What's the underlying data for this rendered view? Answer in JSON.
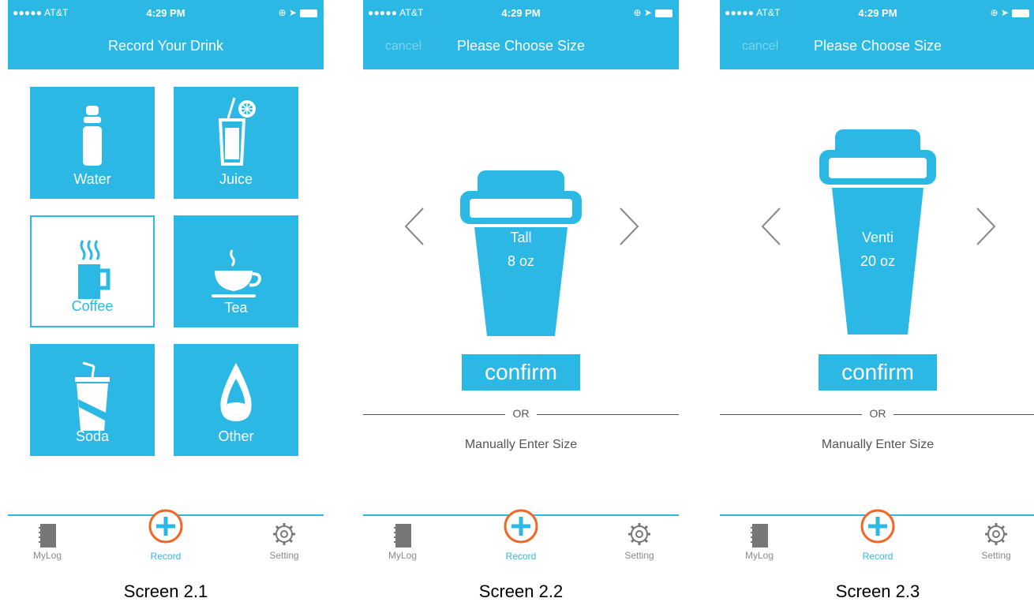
{
  "status": {
    "carrier": "●●●●● AT&T",
    "time": "4:29 PM"
  },
  "screen1": {
    "title": "Record Your Drink",
    "tiles": [
      {
        "label": "Water",
        "icon": "water-bottle-icon"
      },
      {
        "label": "Juice",
        "icon": "juice-glass-icon"
      },
      {
        "label": "Coffee",
        "icon": "coffee-mug-icon",
        "selected": true
      },
      {
        "label": "Tea",
        "icon": "tea-cup-icon"
      },
      {
        "label": "Soda",
        "icon": "soda-cup-icon"
      },
      {
        "label": "Other",
        "icon": "drop-icon"
      }
    ]
  },
  "screen2": {
    "cancel": "cancel",
    "title": "Please Choose Size",
    "size_name": "Tall",
    "size_oz": "8 oz",
    "confirm": "confirm",
    "or": "OR",
    "manual": "Manually Enter Size"
  },
  "screen3": {
    "cancel": "cancel",
    "title": "Please Choose Size",
    "size_name": "Venti",
    "size_oz": "20 oz",
    "confirm": "confirm",
    "or": "OR",
    "manual": "Manually Enter Size"
  },
  "tabbar": {
    "mylog": "MyLog",
    "record": "Record",
    "setting": "Setting"
  },
  "captions": [
    "Screen 2.1",
    "Screen 2.2",
    "Screen 2.3"
  ],
  "colors": {
    "accent": "#2bb8e4",
    "record_ring": "#f26522",
    "text_gray": "#555555"
  }
}
